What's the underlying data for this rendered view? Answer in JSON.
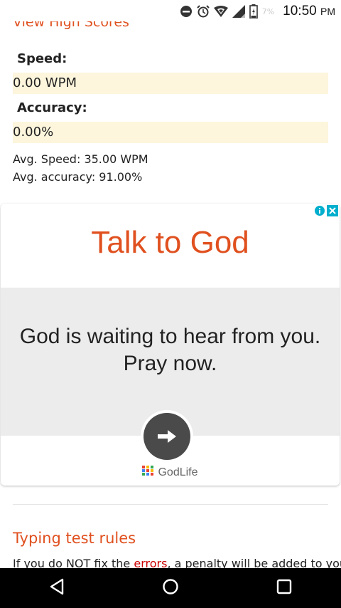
{
  "status_bar": {
    "time": "10:50",
    "ampm": "PM",
    "battery_percent": "7%",
    "icons": [
      "do-not-disturb-icon",
      "alarm-icon",
      "wifi-icon",
      "signal-icon",
      "battery-icon"
    ]
  },
  "results": {
    "view_high_scores_link": "View High Scores",
    "speed_label": "Speed:",
    "speed_value": "0.00 WPM",
    "accuracy_label": "Accuracy:",
    "accuracy_value": "0.00%",
    "avg_speed": "Avg. Speed: 35.00 WPM",
    "avg_accuracy": "Avg. accuracy: 91.00%"
  },
  "ad": {
    "title": "Talk to God",
    "line1": "God is waiting to hear from you.",
    "line2": "Pray now.",
    "brand": "GodLife",
    "cta_icon": "arrow-right-icon",
    "adchoices_icons": [
      "info-icon",
      "close-icon"
    ]
  },
  "rules": {
    "title": "Typing test rules",
    "text_before": "If you do NOT fix the ",
    "text_link": "errors",
    "text_after": ", a penalty will be added to your"
  },
  "navbar": {
    "buttons": [
      "back-icon",
      "home-icon",
      "recents-icon"
    ]
  },
  "colors": {
    "accent": "#e0501f",
    "value_bg": "#fdf6dd",
    "error_link": "#cc0000"
  }
}
